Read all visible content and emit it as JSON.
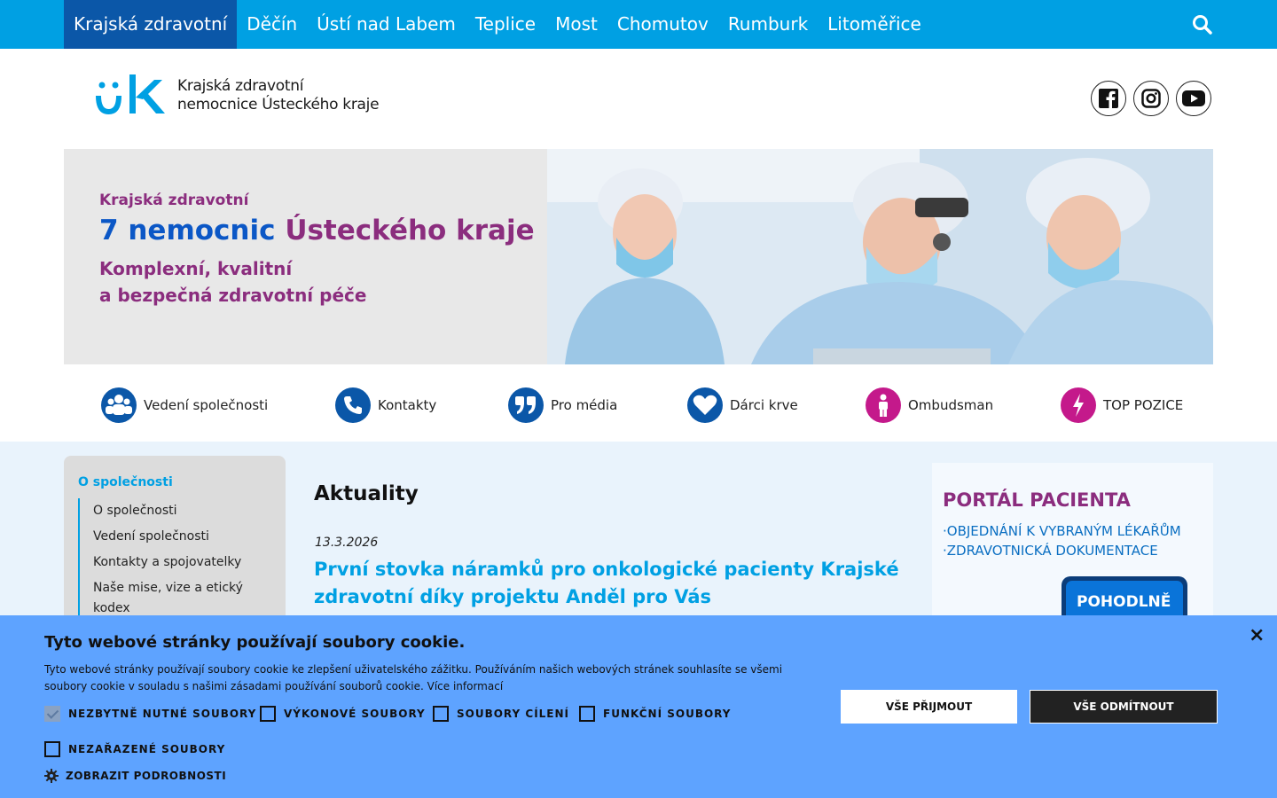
{
  "topnav": {
    "items": [
      "Krajská zdravotní",
      "Děčín",
      "Ústí nad Labem",
      "Teplice",
      "Most",
      "Chomutov",
      "Rumburk",
      "Litoměřice"
    ],
    "active_index": 0,
    "search_icon": "search-icon"
  },
  "header": {
    "logo_line1": "Krajská zdravotní",
    "logo_line2": "nemocnice Ústeckého kraje",
    "social": [
      "facebook-icon",
      "instagram-icon",
      "youtube-icon"
    ]
  },
  "banner": {
    "line1": "Krajská zdravotní",
    "line2_a": "7 nemocnic",
    "line2_b": "Ústeckého kraje",
    "line3": "Komplexní, kvalitní",
    "line4": "a bezpečná zdravotní péče"
  },
  "quick_links": [
    {
      "label": "Vedení společnosti",
      "icon": "users-icon",
      "color": "#0b57a8"
    },
    {
      "label": "Kontakty",
      "icon": "phone-icon",
      "color": "#0b57a8"
    },
    {
      "label": "Pro média",
      "icon": "quote-icon",
      "color": "#0b57a8"
    },
    {
      "label": "Dárci krve",
      "icon": "heart-icon",
      "color": "#0b57a8"
    },
    {
      "label": "Ombudsman",
      "icon": "person-icon",
      "color": "#c4198b"
    },
    {
      "label": "TOP POZICE",
      "icon": "bolt-icon",
      "color": "#c4198b"
    }
  ],
  "sidebar": {
    "heading": "O společnosti",
    "items": [
      "O společnosti",
      "Vedení společnosti",
      "Kontakty a spojovatelky",
      "Naše mise, vize a etický kodex"
    ]
  },
  "main": {
    "title": "Aktuality",
    "news": [
      {
        "date": "13.3.2026",
        "title": "První stovka náramků pro onkologické pacienty Krajské zdravotní díky projektu Anděl pro Vás"
      }
    ]
  },
  "portal": {
    "title": "PORTÁL PACIENTA",
    "line1": "·OBJEDNÁNÍ K VYBRANÝM LÉKAŘŮM",
    "line2": "·ZDRAVOTNICKÁ DOKUMENTACE",
    "button": "POHODLNĚ"
  },
  "cookie": {
    "title": "Tyto webové stránky používají soubory cookie.",
    "text": "Tyto webové stránky používají soubory cookie ke zlepšení uživatelského zážitku. Používáním našich webových stránek souhlasíte se všemi soubory cookie v souladu s našimi zásadami používání souborů cookie. Více informací",
    "options": [
      {
        "label": "NEZBYTNĚ NUTNÉ SOUBORY",
        "checked": true
      },
      {
        "label": "VÝKONOVÉ SOUBORY",
        "checked": false
      },
      {
        "label": "SOUBORY CÍLENÍ",
        "checked": false
      },
      {
        "label": "FUNKČNÍ SOUBORY",
        "checked": false
      },
      {
        "label": "NEZAŘAZENÉ SOUBORY",
        "checked": false
      }
    ],
    "accept_label": "VŠE PŘIJMOUT",
    "reject_label": "VŠE ODMÍTNOUT",
    "details_label": "ZOBRAZIT PODROBNOSTI",
    "close_symbol": "×"
  }
}
